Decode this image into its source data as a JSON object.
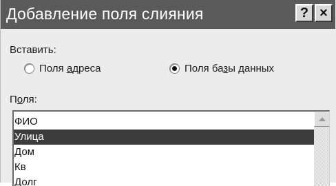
{
  "window": {
    "title": "Добавление поля слияния",
    "help_label": "?",
    "close_label": "×"
  },
  "insert": {
    "label": "Вставить:",
    "options": [
      {
        "pre": "Поля ",
        "underline": "а",
        "post": "дреса",
        "checked": false
      },
      {
        "pre": "Поля ба",
        "underline": "з",
        "post": "ы данных",
        "checked": true
      }
    ]
  },
  "fields": {
    "label_pre": "П",
    "label_underline": "о",
    "label_post": "ля:",
    "items": [
      "ФИО",
      "Улица",
      "Дом",
      "Кв",
      "Долг"
    ],
    "selected_index": 1
  },
  "icons": {
    "scroll_up": "arrow-up-icon",
    "radio": "radio-icon"
  }
}
